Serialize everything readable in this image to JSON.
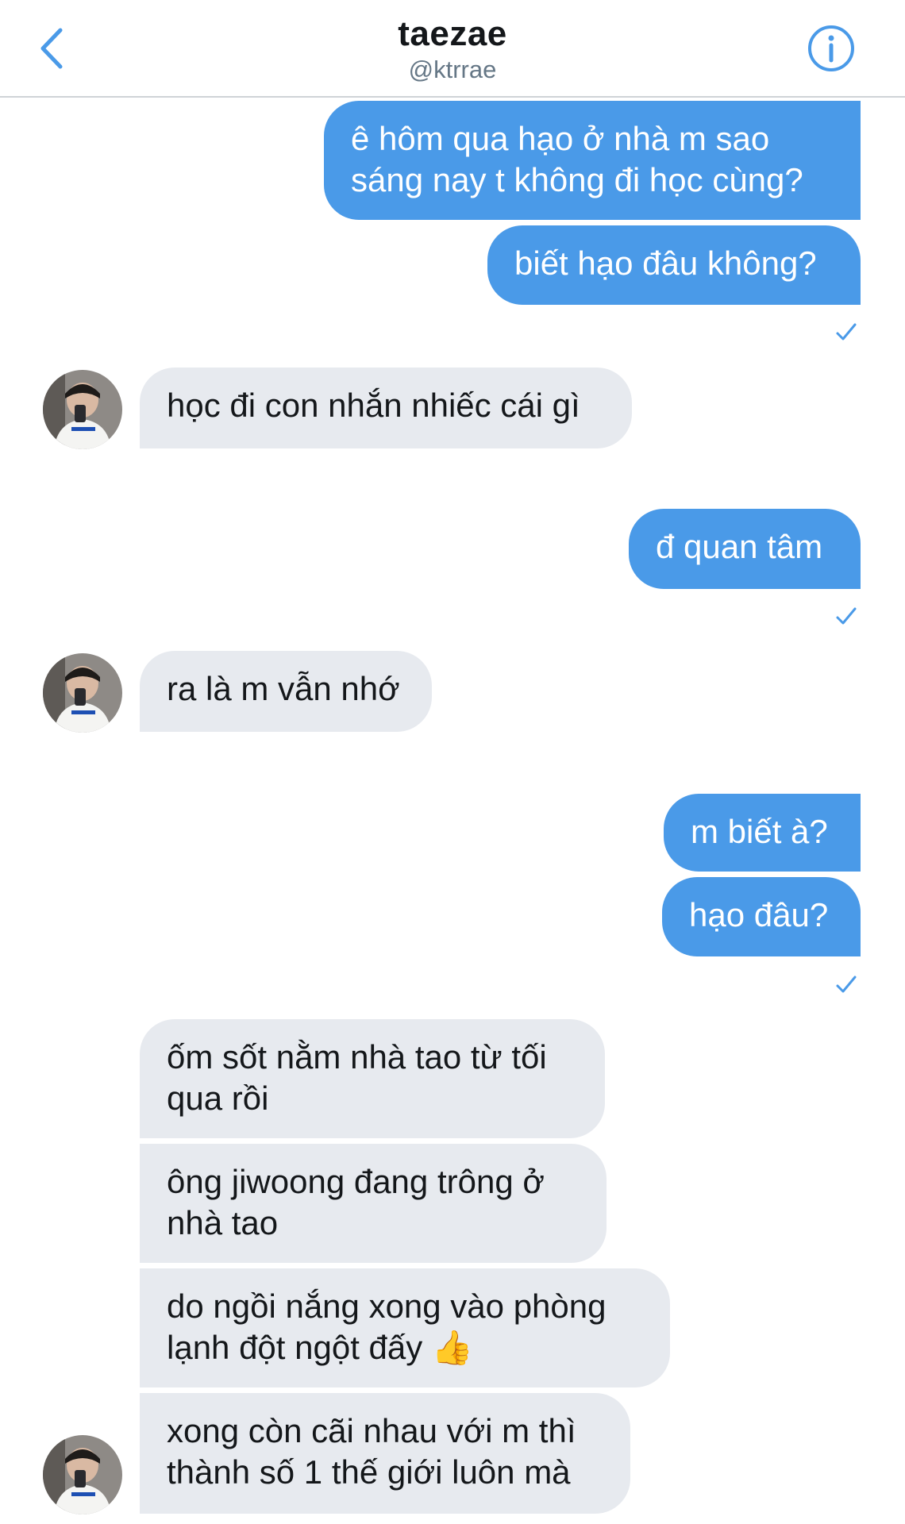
{
  "header": {
    "title": "taezae",
    "handle": "@ktrrae"
  },
  "colors": {
    "accent": "#4a9ae8",
    "incoming_bubble": "#e7eaef",
    "text_dark": "#14171a",
    "text_muted": "#657786"
  },
  "messages": [
    {
      "side": "out",
      "text": "ê hôm qua hạo ở nhà m sao\nsáng nay t không đi học cùng?"
    },
    {
      "side": "out",
      "text": "biết hạo đâu không?",
      "seen": true
    },
    {
      "side": "in",
      "text": "học đi con nhắn nhiếc cái gì",
      "avatar": true
    },
    {
      "side": "out",
      "text": "đ quan tâm",
      "seen": true
    },
    {
      "side": "in",
      "text": "ra là m vẫn nhớ",
      "avatar": true
    },
    {
      "side": "out",
      "text": "m biết à?"
    },
    {
      "side": "out",
      "text": "hạo đâu?",
      "seen": true
    },
    {
      "side": "in",
      "text": "ốm sốt nằm nhà tao từ tối\nqua rồi"
    },
    {
      "side": "in",
      "text": "ông jiwoong đang trông ở\nnhà tao"
    },
    {
      "side": "in",
      "text": "do ngồi nắng xong vào phòng\nlạnh đột ngột đấy 👍"
    },
    {
      "side": "in",
      "text": "xong còn cãi nhau với m thì\nthành số 1 thế giới luôn mà",
      "avatar": true
    }
  ]
}
